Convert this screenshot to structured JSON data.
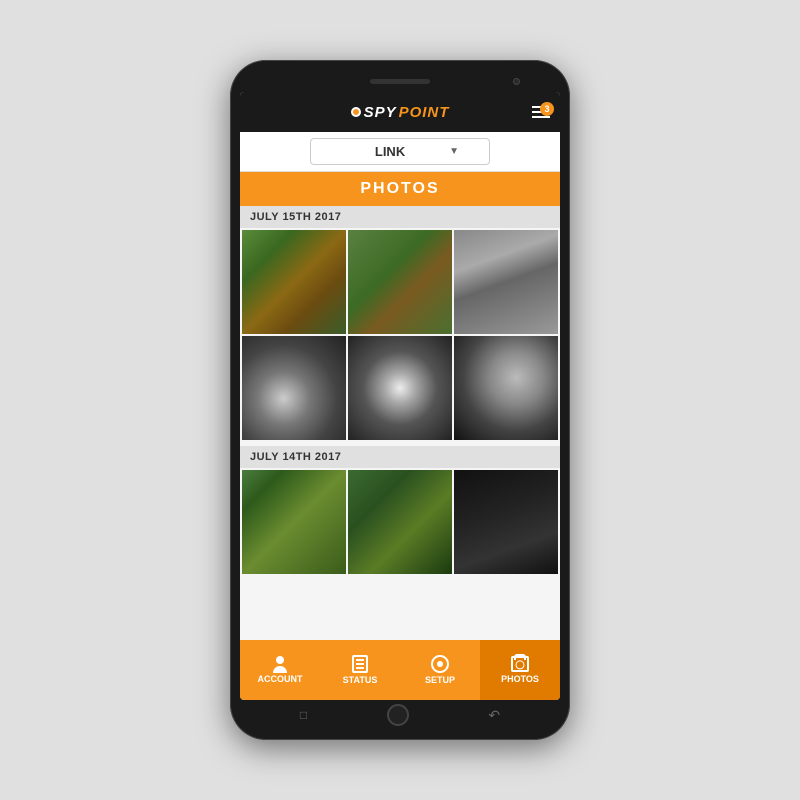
{
  "phone": {
    "header": {
      "logo_spy": "SPY",
      "logo_point": "POINT",
      "menu_badge": "3"
    },
    "device_selector": {
      "current_device": "LINK",
      "dropdown_arrow": "▼"
    },
    "photos_title": "PHOTOS",
    "dates": [
      {
        "label": "JULY 15TH 2017",
        "photos": [
          {
            "id": 1,
            "style_class": "photo-1"
          },
          {
            "id": 2,
            "style_class": "photo-2"
          },
          {
            "id": 3,
            "style_class": "photo-3"
          },
          {
            "id": 4,
            "style_class": "photo-4"
          },
          {
            "id": 5,
            "style_class": "photo-5"
          },
          {
            "id": 6,
            "style_class": "photo-6"
          }
        ]
      },
      {
        "label": "JULY 14TH 2017",
        "photos": [
          {
            "id": 7,
            "style_class": "photo-7"
          },
          {
            "id": 8,
            "style_class": "photo-8"
          },
          {
            "id": 9,
            "style_class": "photo-9"
          }
        ]
      }
    ],
    "nav": {
      "items": [
        {
          "id": "account",
          "label": "Account",
          "active": false
        },
        {
          "id": "status",
          "label": "Status",
          "active": false
        },
        {
          "id": "setup",
          "label": "Setup",
          "active": false
        },
        {
          "id": "photos",
          "label": "Photos",
          "active": true
        }
      ]
    }
  }
}
